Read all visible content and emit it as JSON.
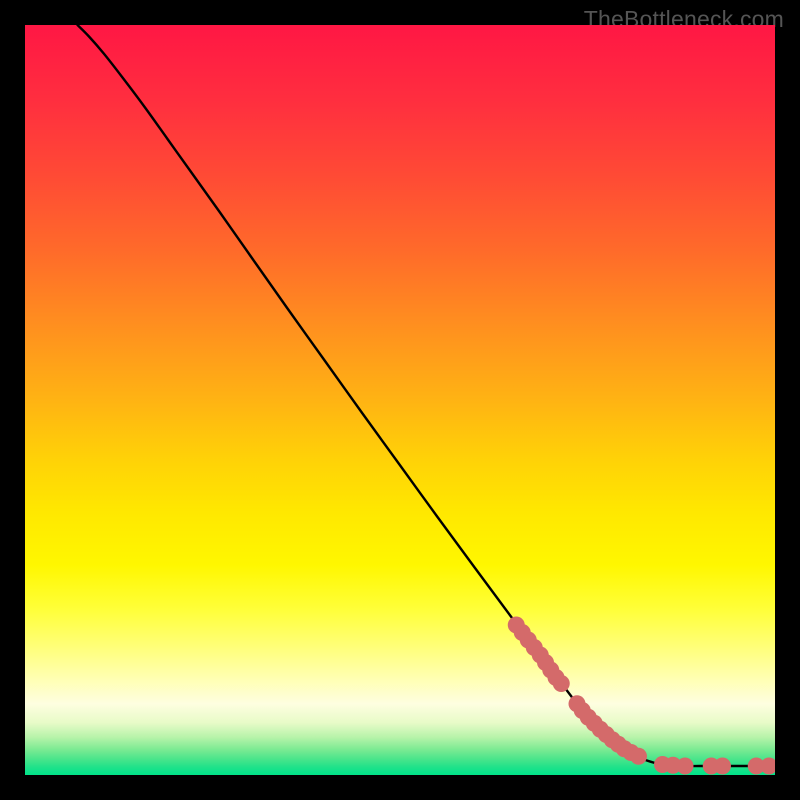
{
  "watermark": "TheBottleneck.com",
  "chart_data": {
    "type": "line",
    "title": "",
    "xlabel": "",
    "ylabel": "",
    "xlim": [
      0,
      100
    ],
    "ylim": [
      0,
      100
    ],
    "plot_size": 750,
    "gradient_stops": [
      {
        "offset": 0.0,
        "color": "#ff1744"
      },
      {
        "offset": 0.1,
        "color": "#ff2e3f"
      },
      {
        "offset": 0.2,
        "color": "#ff4a35"
      },
      {
        "offset": 0.3,
        "color": "#ff6a2a"
      },
      {
        "offset": 0.4,
        "color": "#ff8f1f"
      },
      {
        "offset": 0.5,
        "color": "#ffb313"
      },
      {
        "offset": 0.58,
        "color": "#ffd207"
      },
      {
        "offset": 0.65,
        "color": "#ffe800"
      },
      {
        "offset": 0.72,
        "color": "#fff700"
      },
      {
        "offset": 0.78,
        "color": "#ffff3a"
      },
      {
        "offset": 0.83,
        "color": "#ffff7a"
      },
      {
        "offset": 0.87,
        "color": "#ffffb0"
      },
      {
        "offset": 0.905,
        "color": "#fefee0"
      },
      {
        "offset": 0.93,
        "color": "#e8fbc8"
      },
      {
        "offset": 0.95,
        "color": "#b6f3a9"
      },
      {
        "offset": 0.965,
        "color": "#7feb94"
      },
      {
        "offset": 0.978,
        "color": "#4de58b"
      },
      {
        "offset": 0.99,
        "color": "#1ee28a"
      },
      {
        "offset": 1.0,
        "color": "#00e389"
      }
    ],
    "curve": [
      {
        "x": 7.0,
        "y": 100.0
      },
      {
        "x": 8.5,
        "y": 98.5
      },
      {
        "x": 10.5,
        "y": 96.2
      },
      {
        "x": 13.0,
        "y": 93.0
      },
      {
        "x": 16.0,
        "y": 89.0
      },
      {
        "x": 19.0,
        "y": 84.8
      },
      {
        "x": 22.0,
        "y": 80.6
      },
      {
        "x": 26.0,
        "y": 75.0
      },
      {
        "x": 30.0,
        "y": 69.3
      },
      {
        "x": 35.0,
        "y": 62.2
      },
      {
        "x": 40.0,
        "y": 55.2
      },
      {
        "x": 45.0,
        "y": 48.2
      },
      {
        "x": 50.0,
        "y": 41.3
      },
      {
        "x": 55.0,
        "y": 34.4
      },
      {
        "x": 60.0,
        "y": 27.6
      },
      {
        "x": 64.0,
        "y": 22.2
      },
      {
        "x": 66.0,
        "y": 19.5
      },
      {
        "x": 68.0,
        "y": 16.8
      },
      {
        "x": 70.0,
        "y": 14.2
      },
      {
        "x": 72.0,
        "y": 11.6
      },
      {
        "x": 74.0,
        "y": 9.0
      },
      {
        "x": 76.0,
        "y": 6.8
      },
      {
        "x": 78.0,
        "y": 5.0
      },
      {
        "x": 80.0,
        "y": 3.4
      },
      {
        "x": 82.0,
        "y": 2.3
      },
      {
        "x": 84.0,
        "y": 1.6
      },
      {
        "x": 86.0,
        "y": 1.3
      },
      {
        "x": 88.0,
        "y": 1.2
      },
      {
        "x": 90.0,
        "y": 1.2
      },
      {
        "x": 92.0,
        "y": 1.2
      },
      {
        "x": 94.0,
        "y": 1.2
      },
      {
        "x": 96.0,
        "y": 1.2
      },
      {
        "x": 98.0,
        "y": 1.2
      },
      {
        "x": 100.0,
        "y": 1.2
      }
    ],
    "dots": [
      {
        "x": 65.5,
        "y": 20.0
      },
      {
        "x": 66.3,
        "y": 19.0
      },
      {
        "x": 67.1,
        "y": 18.0
      },
      {
        "x": 67.9,
        "y": 17.0
      },
      {
        "x": 68.7,
        "y": 16.0
      },
      {
        "x": 69.4,
        "y": 15.0
      },
      {
        "x": 70.1,
        "y": 14.0
      },
      {
        "x": 70.8,
        "y": 13.0
      },
      {
        "x": 71.5,
        "y": 12.2
      },
      {
        "x": 73.6,
        "y": 9.5
      },
      {
        "x": 74.3,
        "y": 8.6
      },
      {
        "x": 75.1,
        "y": 7.7
      },
      {
        "x": 75.9,
        "y": 6.9
      },
      {
        "x": 76.7,
        "y": 6.1
      },
      {
        "x": 77.5,
        "y": 5.4
      },
      {
        "x": 78.3,
        "y": 4.7
      },
      {
        "x": 79.1,
        "y": 4.1
      },
      {
        "x": 79.9,
        "y": 3.5
      },
      {
        "x": 80.8,
        "y": 3.0
      },
      {
        "x": 81.8,
        "y": 2.5
      },
      {
        "x": 85.0,
        "y": 1.4
      },
      {
        "x": 86.4,
        "y": 1.3
      },
      {
        "x": 88.0,
        "y": 1.2
      },
      {
        "x": 91.5,
        "y": 1.2
      },
      {
        "x": 93.0,
        "y": 1.2
      },
      {
        "x": 97.5,
        "y": 1.2
      },
      {
        "x": 99.2,
        "y": 1.2
      }
    ],
    "dot_color": "#d46a6a",
    "dot_radius": 8.5,
    "line_color": "#000000",
    "line_width": 2.4
  }
}
